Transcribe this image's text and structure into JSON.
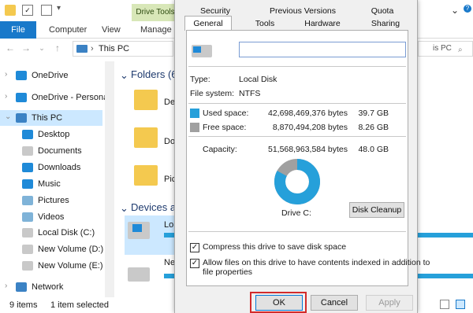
{
  "explorer": {
    "drive_tools_label": "Drive Tools",
    "ribbon_tabs": [
      "File",
      "Computer",
      "View",
      "Manage"
    ],
    "address": "This PC",
    "search_fragment": "is PC",
    "nav_items": [
      "OneDrive",
      "OneDrive - Personal",
      "This PC",
      "Desktop",
      "Documents",
      "Downloads",
      "Music",
      "Pictures",
      "Videos",
      "Local Disk (C:)",
      "New Volume (D:)",
      "New Volume (E:)",
      "Network"
    ],
    "folders_heading": "Folders (6",
    "folder_labels": [
      "De",
      "Do",
      "Pic"
    ],
    "devices_heading": "Devices a",
    "device_labels": [
      "Lo",
      "Ne"
    ],
    "status_items": "9 items",
    "status_selected": "1 item selected",
    "selected_nav_index": 2
  },
  "dialog": {
    "tabs_row1": [
      "Security",
      "Previous Versions",
      "Quota"
    ],
    "tabs_row2": [
      "General",
      "Tools",
      "Hardware",
      "Sharing"
    ],
    "name_value": "",
    "type_label": "Type:",
    "type_value": "Local Disk",
    "fs_label": "File system:",
    "fs_value": "NTFS",
    "used_label": "Used space:",
    "used_bytes": "42,698,469,376 bytes",
    "used_gb": "39.7 GB",
    "free_label": "Free space:",
    "free_bytes": "8,870,494,208 bytes",
    "free_gb": "8.26 GB",
    "capacity_label": "Capacity:",
    "capacity_bytes": "51,568,963,584 bytes",
    "capacity_gb": "48.0 GB",
    "drive_label": "Drive C:",
    "disk_cleanup_label": "Disk Cleanup",
    "compress_label": "Compress this drive to save disk space",
    "index_label_line1": "Allow files on this drive to have contents indexed in addition to",
    "index_label_line2": "file properties",
    "compress_checked": true,
    "index_checked": true,
    "ok_label": "OK",
    "cancel_label": "Cancel",
    "apply_label": "Apply",
    "used_fraction": 0.828,
    "colors": {
      "used": "#26a0da",
      "free": "#a0a0a0",
      "highlight": "#d22b2b"
    }
  }
}
